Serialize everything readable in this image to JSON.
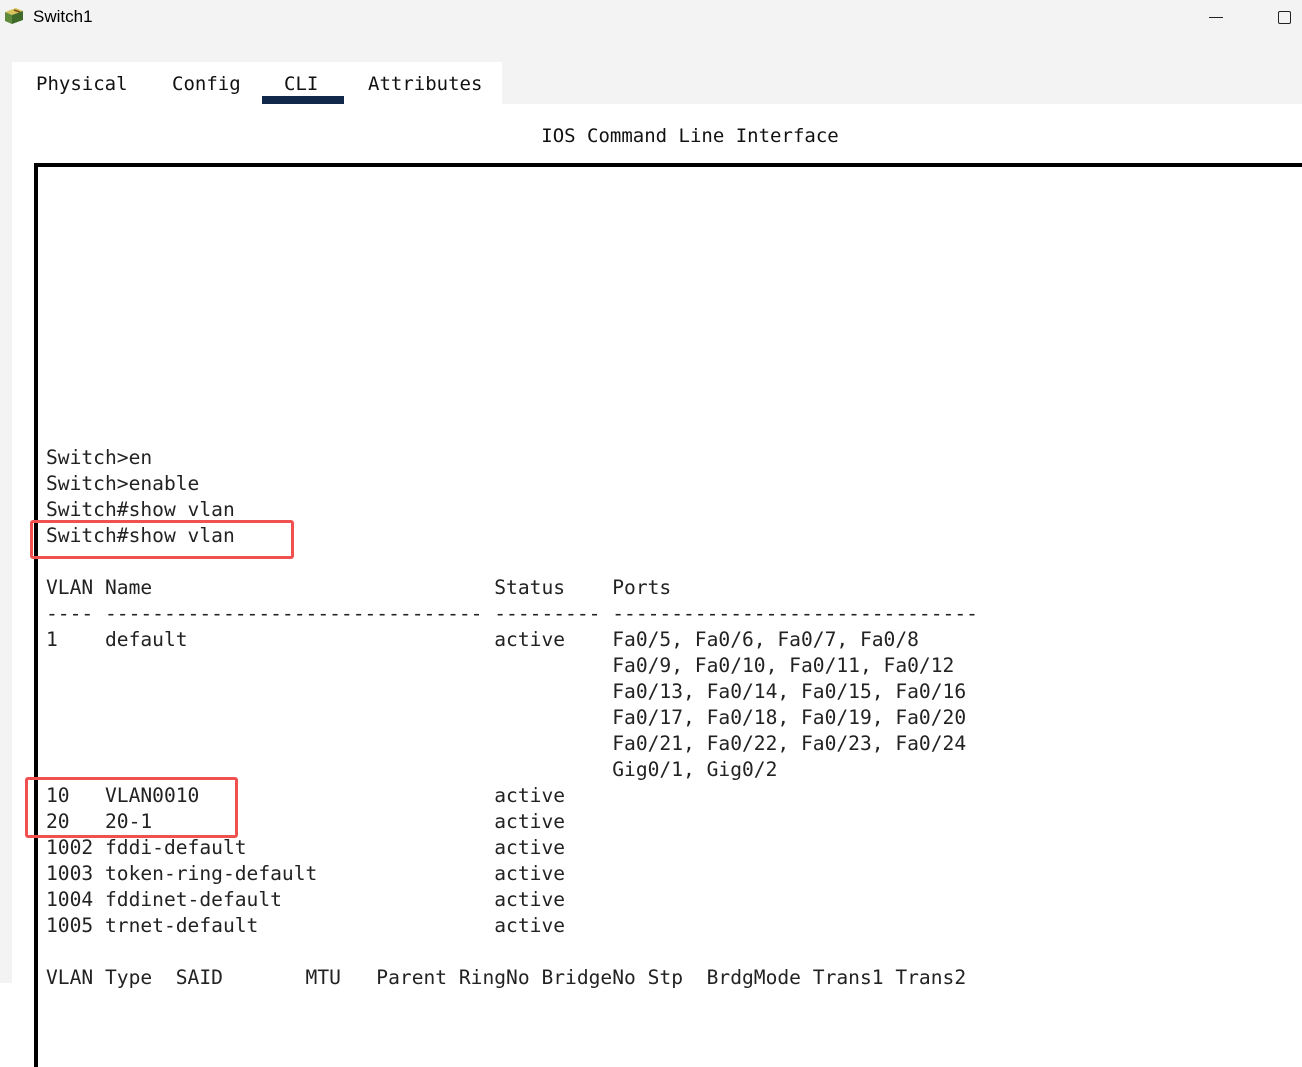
{
  "window": {
    "title": "Switch1",
    "icon": "switch-device-icon"
  },
  "tabs": [
    {
      "label": "Physical",
      "selected": false
    },
    {
      "label": "Config",
      "selected": false
    },
    {
      "label": "CLI",
      "selected": true
    },
    {
      "label": "Attributes",
      "selected": false
    }
  ],
  "cli": {
    "heading": "IOS Command Line Interface",
    "highlight_color": "#f05050",
    "lines": [
      "Switch>en",
      "Switch>enable",
      "Switch#show vlan",
      "Switch#show vlan",
      "",
      "VLAN Name                             Status    Ports",
      "---- -------------------------------- --------- -------------------------------",
      "1    default                          active    Fa0/5, Fa0/6, Fa0/7, Fa0/8",
      "                                                Fa0/9, Fa0/10, Fa0/11, Fa0/12",
      "                                                Fa0/13, Fa0/14, Fa0/15, Fa0/16",
      "                                                Fa0/17, Fa0/18, Fa0/19, Fa0/20",
      "                                                Fa0/21, Fa0/22, Fa0/23, Fa0/24",
      "                                                Gig0/1, Gig0/2",
      "10   VLAN0010                         active",
      "20   20-1                             active",
      "1002 fddi-default                     active",
      "1003 token-ring-default               active",
      "1004 fddinet-default                  active",
      "1005 trnet-default                    active",
      "",
      "VLAN Type  SAID       MTU   Parent RingNo BridgeNo Stp  BrdgMode Trans1 Trans2"
    ]
  }
}
